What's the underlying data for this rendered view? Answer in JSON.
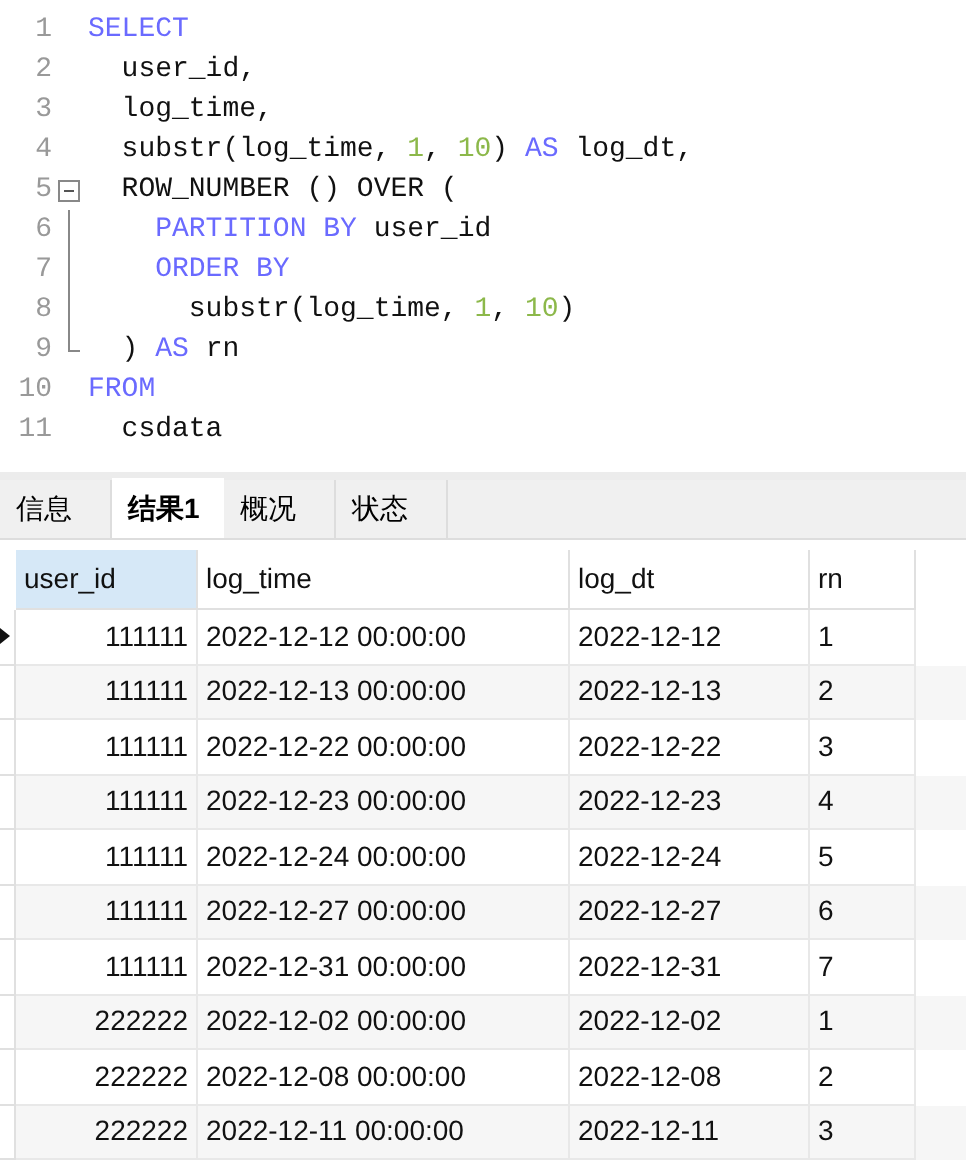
{
  "editor": {
    "lines": [
      {
        "number": "1",
        "tokens": [
          {
            "kind": "keyword",
            "text": "SELECT"
          }
        ]
      },
      {
        "number": "2",
        "tokens": [
          {
            "kind": "plain",
            "text": "  user_id,"
          }
        ]
      },
      {
        "number": "3",
        "tokens": [
          {
            "kind": "plain",
            "text": "  log_time,"
          }
        ]
      },
      {
        "number": "4",
        "tokens": [
          {
            "kind": "plain",
            "text": "  substr(log_time, "
          },
          {
            "kind": "number",
            "text": "1"
          },
          {
            "kind": "plain",
            "text": ", "
          },
          {
            "kind": "number",
            "text": "10"
          },
          {
            "kind": "plain",
            "text": ") "
          },
          {
            "kind": "keyword",
            "text": "AS"
          },
          {
            "kind": "plain",
            "text": " log_dt,"
          }
        ]
      },
      {
        "number": "5",
        "fold_start": true,
        "tokens": [
          {
            "kind": "plain",
            "text": "  ROW_NUMBER () OVER ("
          }
        ]
      },
      {
        "number": "6",
        "fold_inside": true,
        "tokens": [
          {
            "kind": "keyword",
            "text": "    PARTITION BY"
          },
          {
            "kind": "plain",
            "text": " user_id"
          }
        ]
      },
      {
        "number": "7",
        "fold_inside": true,
        "tokens": [
          {
            "kind": "keyword",
            "text": "    ORDER BY"
          }
        ]
      },
      {
        "number": "8",
        "fold_inside": true,
        "tokens": [
          {
            "kind": "plain",
            "text": "      substr(log_time, "
          },
          {
            "kind": "number",
            "text": "1"
          },
          {
            "kind": "plain",
            "text": ", "
          },
          {
            "kind": "number",
            "text": "10"
          },
          {
            "kind": "plain",
            "text": ")"
          }
        ]
      },
      {
        "number": "9",
        "fold_end": true,
        "tokens": [
          {
            "kind": "plain",
            "text": "  ) "
          },
          {
            "kind": "keyword",
            "text": "AS"
          },
          {
            "kind": "plain",
            "text": " rn"
          }
        ]
      },
      {
        "number": "10",
        "tokens": [
          {
            "kind": "keyword",
            "text": "FROM"
          }
        ]
      },
      {
        "number": "11",
        "tokens": [
          {
            "kind": "plain",
            "text": "  csdata"
          }
        ]
      }
    ]
  },
  "tabs": [
    {
      "label": "信息",
      "selected": false
    },
    {
      "label": "结果1",
      "selected": true
    },
    {
      "label": "概况",
      "selected": false
    },
    {
      "label": "状态",
      "selected": false
    }
  ],
  "table": {
    "columns": [
      {
        "label": "user_id",
        "selected": true
      },
      {
        "label": "log_time",
        "selected": false
      },
      {
        "label": "log_dt",
        "selected": false
      },
      {
        "label": "rn",
        "selected": false
      }
    ],
    "rows": [
      {
        "current": true,
        "cells": [
          "111111",
          "2022-12-12 00:00:00",
          "2022-12-12",
          "1"
        ]
      },
      {
        "current": false,
        "cells": [
          "111111",
          "2022-12-13 00:00:00",
          "2022-12-13",
          "2"
        ]
      },
      {
        "current": false,
        "cells": [
          "111111",
          "2022-12-22 00:00:00",
          "2022-12-22",
          "3"
        ]
      },
      {
        "current": false,
        "cells": [
          "111111",
          "2022-12-23 00:00:00",
          "2022-12-23",
          "4"
        ]
      },
      {
        "current": false,
        "cells": [
          "111111",
          "2022-12-24 00:00:00",
          "2022-12-24",
          "5"
        ]
      },
      {
        "current": false,
        "cells": [
          "111111",
          "2022-12-27 00:00:00",
          "2022-12-27",
          "6"
        ]
      },
      {
        "current": false,
        "cells": [
          "111111",
          "2022-12-31 00:00:00",
          "2022-12-31",
          "7"
        ]
      },
      {
        "current": false,
        "cells": [
          "222222",
          "2022-12-02 00:00:00",
          "2022-12-02",
          "1"
        ]
      },
      {
        "current": false,
        "cells": [
          "222222",
          "2022-12-08 00:00:00",
          "2022-12-08",
          "2"
        ]
      },
      {
        "current": false,
        "cells": [
          "222222",
          "2022-12-11 00:00:00",
          "2022-12-11",
          "3"
        ]
      }
    ]
  }
}
